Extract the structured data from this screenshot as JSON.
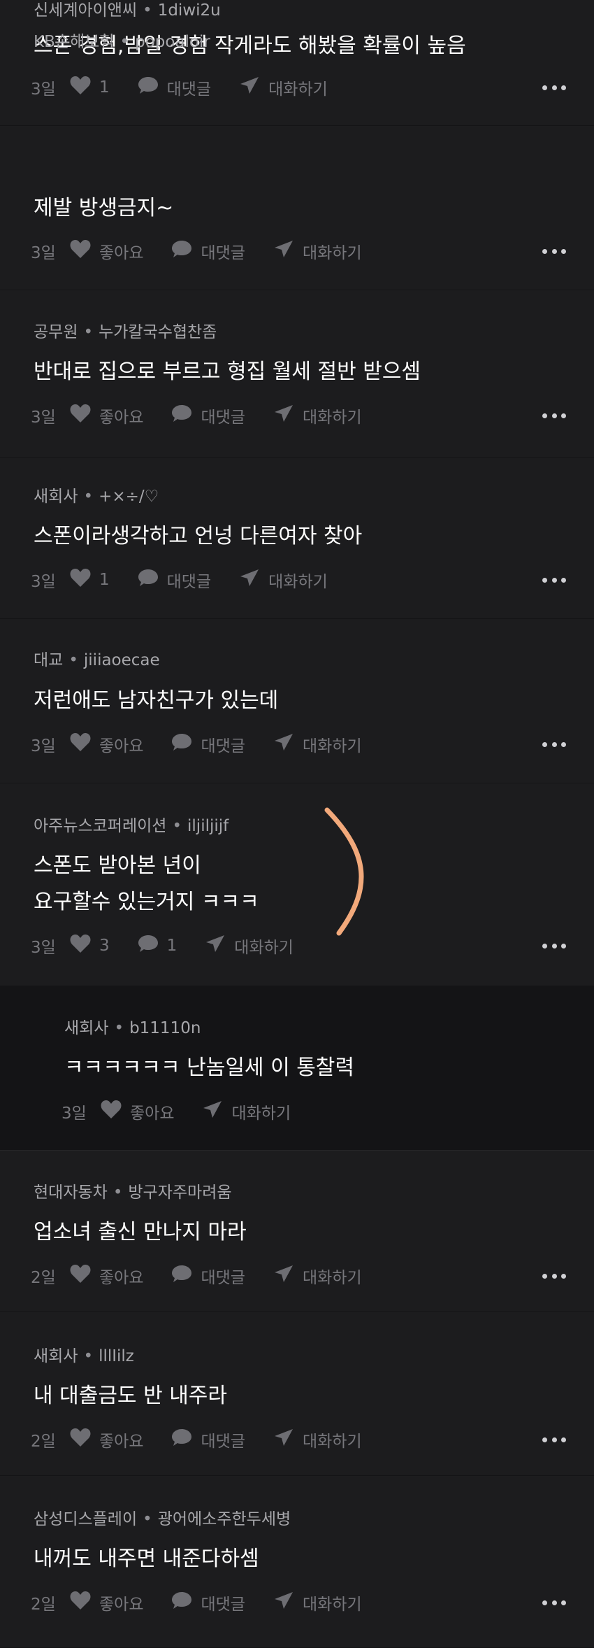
{
  "comments": [
    {
      "company": "신세계아이앤씨",
      "nickname": "1diwi2u",
      "lines": [
        "스폰 경험,밤일 경험 작게라도 해봤을 확률이 높음"
      ],
      "age": "3일",
      "likes": "1",
      "reply": "대댓글",
      "chat": "대화하기"
    },
    {
      "company": "KB손해보험",
      "nickname": "popoaloir",
      "lines": [
        "제발 방생금지~"
      ],
      "age": "3일",
      "likes": "좋아요",
      "reply": "대댓글",
      "chat": "대화하기"
    },
    {
      "company": "공무원",
      "nickname": "누가칼국수협찬좀",
      "lines": [
        "반대로 집으로 부르고 형집 월세 절반 받으셈"
      ],
      "age": "3일",
      "likes": "좋아요",
      "reply": "대댓글",
      "chat": "대화하기"
    },
    {
      "company": "새회사",
      "nickname": "+×÷/♡",
      "lines": [
        "스폰이라생각하고 언넝 다른여자 찾아"
      ],
      "age": "3일",
      "likes": "1",
      "reply": "대댓글",
      "chat": "대화하기"
    },
    {
      "company": "대교",
      "nickname": "jiiiaoecae",
      "lines": [
        "저런애도 남자친구가 있는데"
      ],
      "age": "3일",
      "likes": "좋아요",
      "reply": "대댓글",
      "chat": "대화하기"
    },
    {
      "company": "아주뉴스코퍼레이션",
      "nickname": "iljiljijf",
      "lines": [
        "스폰도 받아본 년이",
        "요구할수 있는거지 ㅋㅋㅋ"
      ],
      "age": "3일",
      "likes": "3",
      "reply": "1",
      "chat": "대화하기"
    },
    {
      "company": "새회사",
      "nickname": "b11110n",
      "lines": [
        "ㅋㅋㅋㅋㅋㅋ 난놈일세 이 통찰력"
      ],
      "age": "3일",
      "likes": "좋아요",
      "reply": "",
      "chat": "대화하기"
    },
    {
      "company": "현대자동차",
      "nickname": "방구자주마려움",
      "lines": [
        "업소녀 출신 만나지 마라"
      ],
      "age": "2일",
      "likes": "좋아요",
      "reply": "대댓글",
      "chat": "대화하기"
    },
    {
      "company": "새회사",
      "nickname": "lllIilz",
      "lines": [
        "내 대출금도 반 내주라"
      ],
      "age": "2일",
      "likes": "좋아요",
      "reply": "대댓글",
      "chat": "대화하기"
    },
    {
      "company": "삼성디스플레이",
      "nickname": "광어에소주한두세병",
      "lines": [
        "내꺼도 내주면 내준다하셈"
      ],
      "age": "2일",
      "likes": "좋아요",
      "reply": "대댓글",
      "chat": "대화하기"
    }
  ],
  "colors": {
    "background": "#1c1c1e",
    "reply_background": "#141416",
    "annotation": "#f2a97b"
  }
}
